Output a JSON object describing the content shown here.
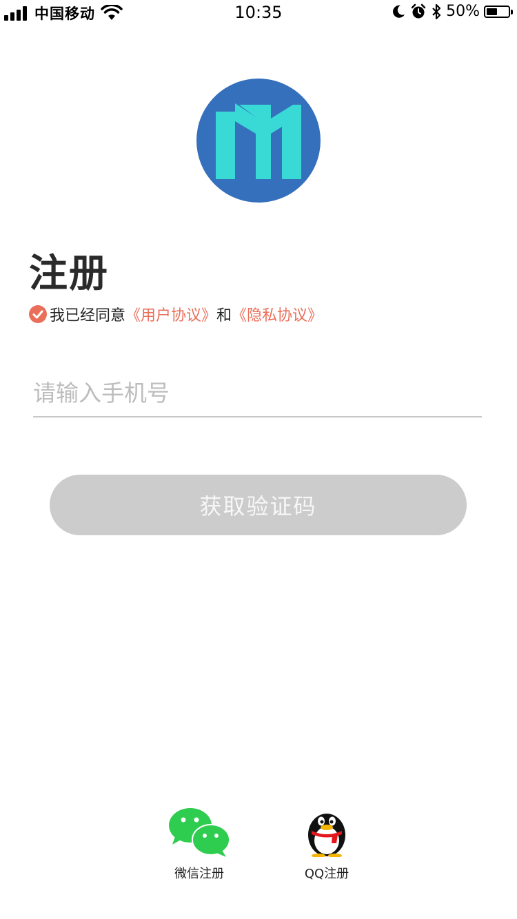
{
  "status_bar": {
    "carrier": "中国移动",
    "time": "10:35",
    "battery_percent": "50%",
    "battery_level": 0.5
  },
  "logo": {
    "icon": "m-logo-icon",
    "bg_color": "#3570bc",
    "mark_color": "#39d9d6"
  },
  "page": {
    "title": "注册"
  },
  "agreement": {
    "prefix": "我已经同意",
    "user_agreement": "《用户协议》",
    "and": "和",
    "privacy_agreement": "《隐私协议》",
    "checked": true,
    "accent_color": "#ea6f5a"
  },
  "form": {
    "phone_placeholder": "请输入手机号",
    "phone_value": "",
    "get_code_label": "获取验证码"
  },
  "social": {
    "wechat_label": "微信注册",
    "qq_label": "QQ注册"
  }
}
